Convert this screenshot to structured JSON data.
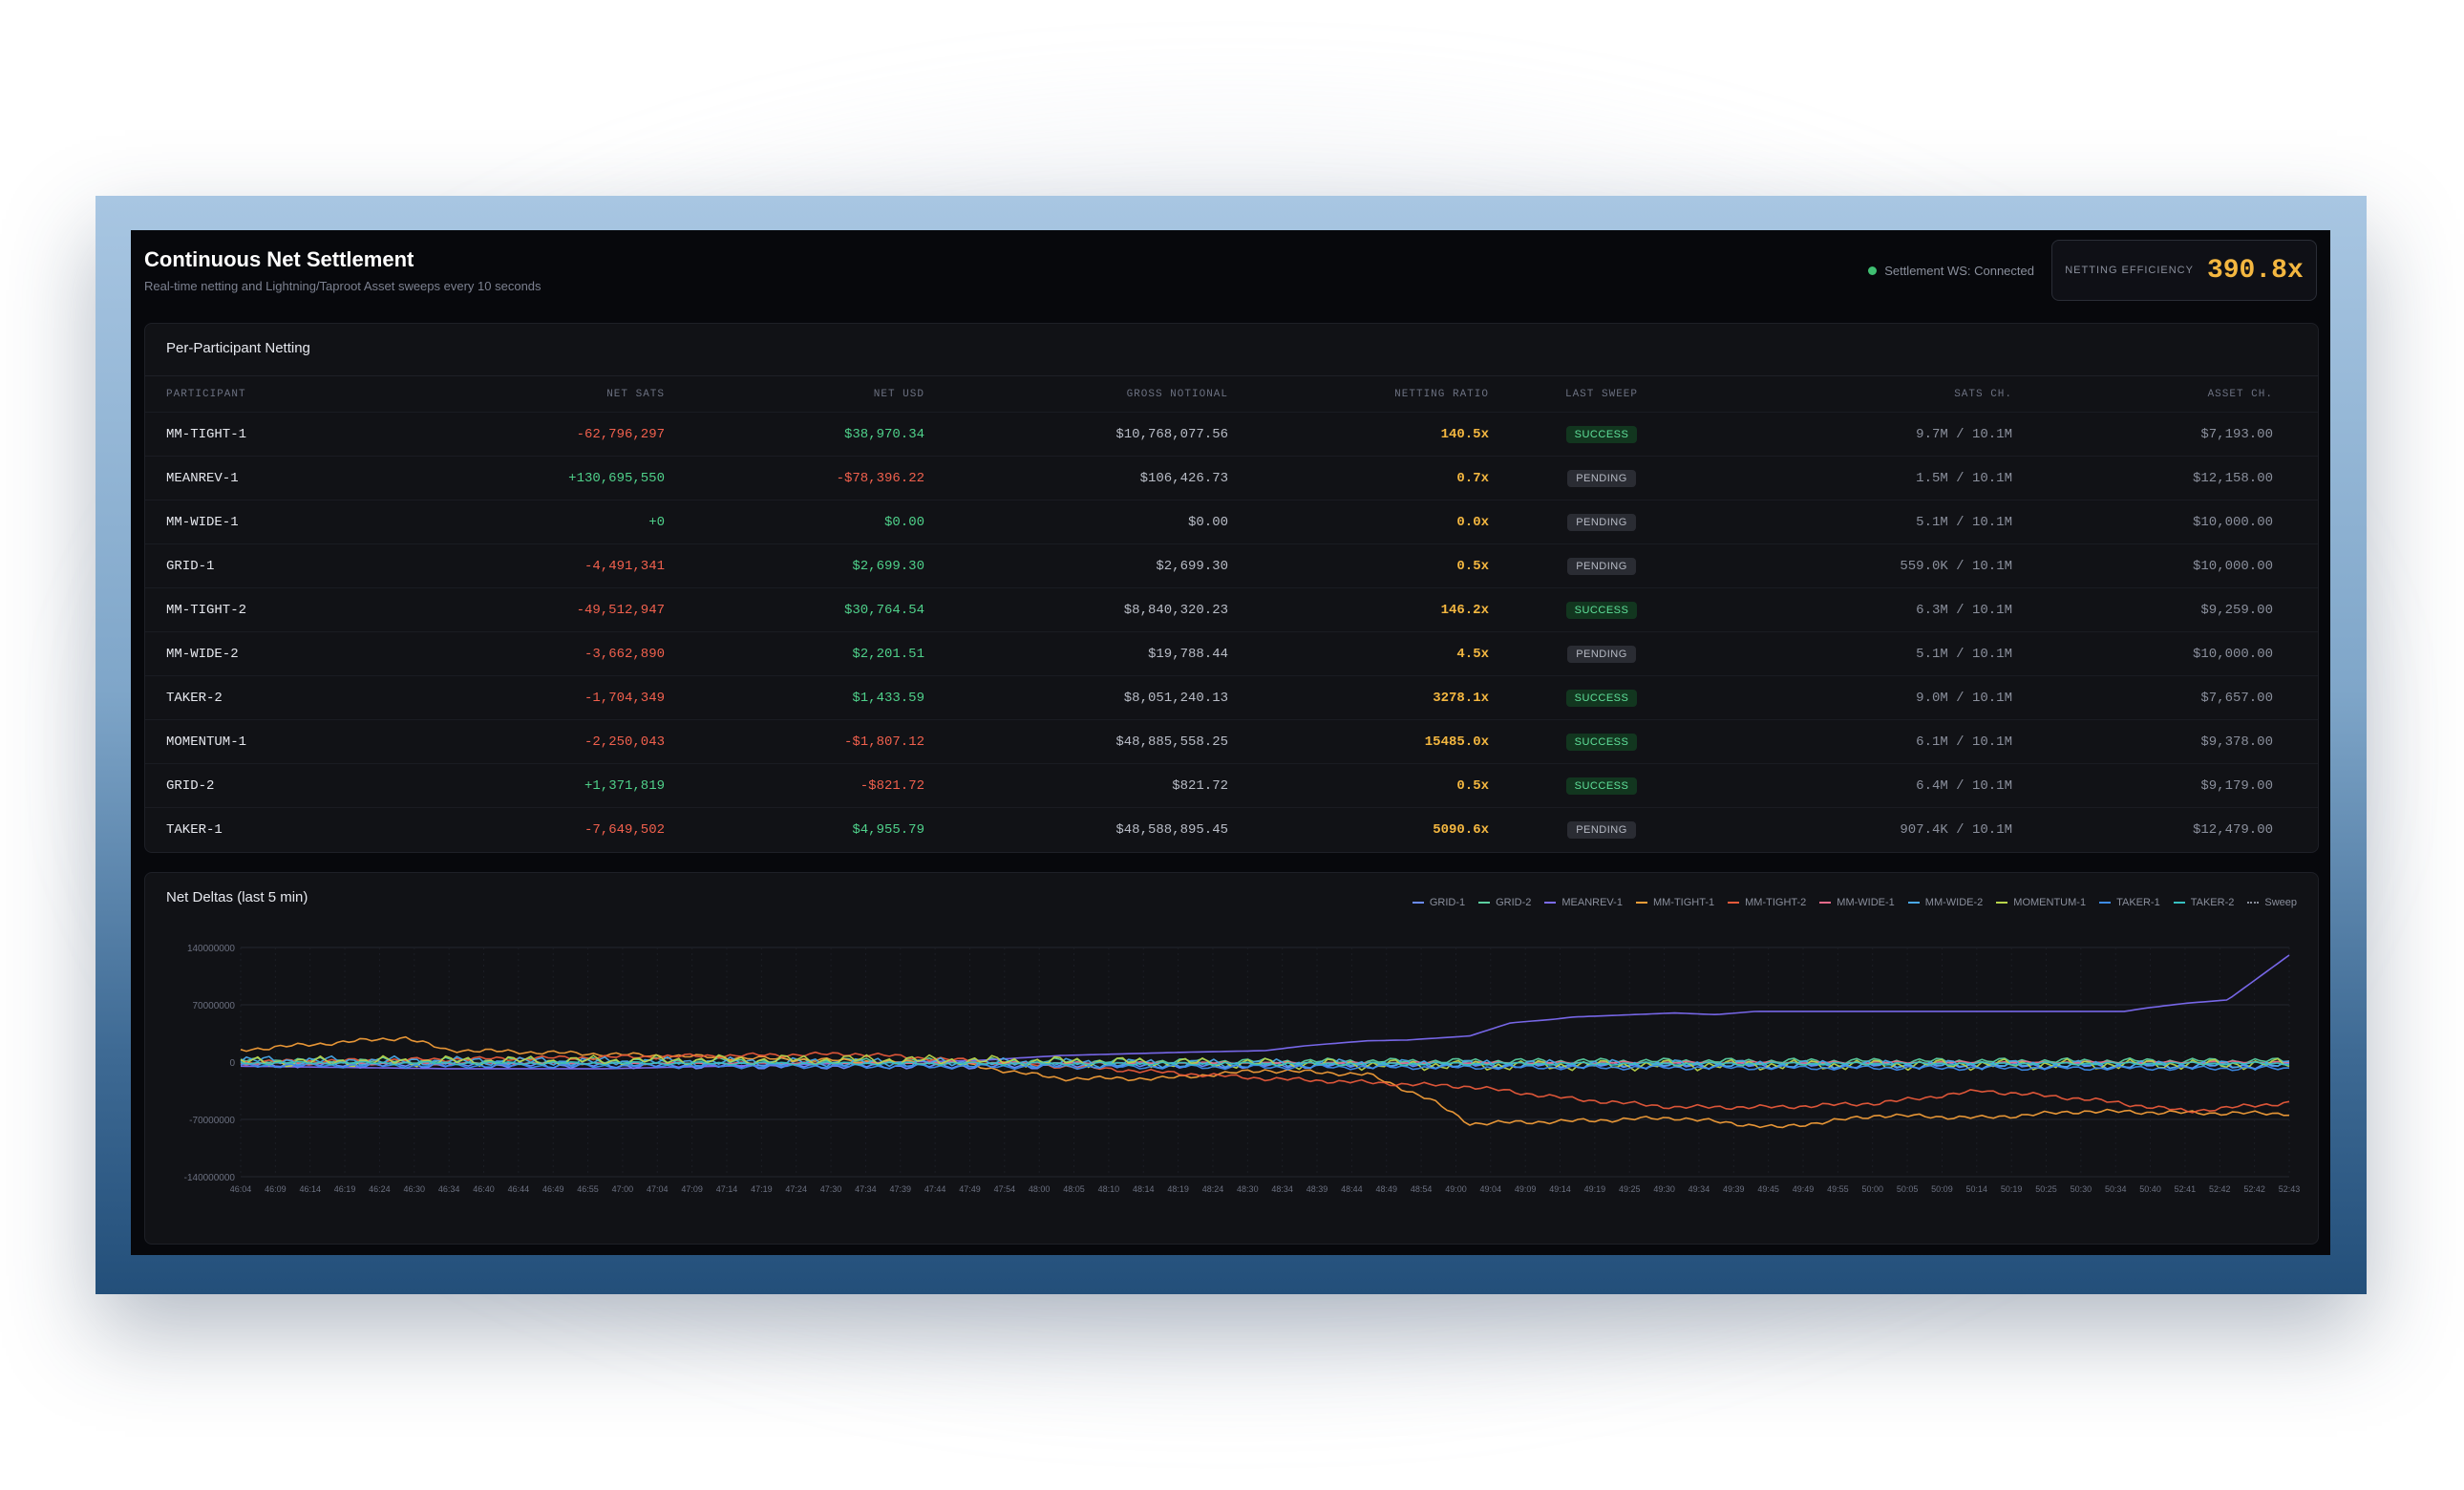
{
  "header": {
    "title": "Continuous Net Settlement",
    "subtitle": "Real-time netting and Lightning/Taproot Asset sweeps every 10 seconds",
    "ws_status": "Settlement WS: Connected",
    "efficiency_label": "NETTING EFFICIENCY",
    "efficiency_value": "390.8x"
  },
  "colors": {
    "positive": "#4fd08a",
    "negative": "#f0604d",
    "ratio": "#f4b740",
    "ws_connected": "#3fbf72"
  },
  "table": {
    "title": "Per-Participant Netting",
    "columns": [
      "PARTICIPANT",
      "NET SATS",
      "NET USD",
      "GROSS NOTIONAL",
      "NETTING RATIO",
      "LAST SWEEP",
      "SATS CH.",
      "ASSET CH."
    ],
    "rows": [
      {
        "participant": "MM-TIGHT-1",
        "net_sats": "-62,796,297",
        "net_usd": "$38,970.34",
        "gross": "$10,768,077.56",
        "ratio": "140.5x",
        "sweep": "SUCCESS",
        "sats_ch": "9.7M / 10.1M",
        "asset_ch": "$7,193.00"
      },
      {
        "participant": "MEANREV-1",
        "net_sats": "+130,695,550",
        "net_usd": "-$78,396.22",
        "gross": "$106,426.73",
        "ratio": "0.7x",
        "sweep": "PENDING",
        "sats_ch": "1.5M / 10.1M",
        "asset_ch": "$12,158.00"
      },
      {
        "participant": "MM-WIDE-1",
        "net_sats": "+0",
        "net_usd": "$0.00",
        "gross": "$0.00",
        "ratio": "0.0x",
        "sweep": "PENDING",
        "sats_ch": "5.1M / 10.1M",
        "asset_ch": "$10,000.00"
      },
      {
        "participant": "GRID-1",
        "net_sats": "-4,491,341",
        "net_usd": "$2,699.30",
        "gross": "$2,699.30",
        "ratio": "0.5x",
        "sweep": "PENDING",
        "sats_ch": "559.0K / 10.1M",
        "asset_ch": "$10,000.00"
      },
      {
        "participant": "MM-TIGHT-2",
        "net_sats": "-49,512,947",
        "net_usd": "$30,764.54",
        "gross": "$8,840,320.23",
        "ratio": "146.2x",
        "sweep": "SUCCESS",
        "sats_ch": "6.3M / 10.1M",
        "asset_ch": "$9,259.00"
      },
      {
        "participant": "MM-WIDE-2",
        "net_sats": "-3,662,890",
        "net_usd": "$2,201.51",
        "gross": "$19,788.44",
        "ratio": "4.5x",
        "sweep": "PENDING",
        "sats_ch": "5.1M / 10.1M",
        "asset_ch": "$10,000.00"
      },
      {
        "participant": "TAKER-2",
        "net_sats": "-1,704,349",
        "net_usd": "$1,433.59",
        "gross": "$8,051,240.13",
        "ratio": "3278.1x",
        "sweep": "SUCCESS",
        "sats_ch": "9.0M / 10.1M",
        "asset_ch": "$7,657.00"
      },
      {
        "participant": "MOMENTUM-1",
        "net_sats": "-2,250,043",
        "net_usd": "-$1,807.12",
        "gross": "$48,885,558.25",
        "ratio": "15485.0x",
        "sweep": "SUCCESS",
        "sats_ch": "6.1M / 10.1M",
        "asset_ch": "$9,378.00"
      },
      {
        "participant": "GRID-2",
        "net_sats": "+1,371,819",
        "net_usd": "-$821.72",
        "gross": "$821.72",
        "ratio": "0.5x",
        "sweep": "SUCCESS",
        "sats_ch": "6.4M / 10.1M",
        "asset_ch": "$9,179.00"
      },
      {
        "participant": "TAKER-1",
        "net_sats": "-7,649,502",
        "net_usd": "$4,955.79",
        "gross": "$48,588,895.45",
        "ratio": "5090.6x",
        "sweep": "PENDING",
        "sats_ch": "907.4K / 10.1M",
        "asset_ch": "$12,479.00"
      }
    ]
  },
  "chart_panel": {
    "title": "Net Deltas (last 5 min)"
  },
  "chart_data": {
    "type": "line",
    "ylim": [
      -140000000,
      140000000
    ],
    "y_ticks": [
      "140000000",
      "70000000",
      "0",
      "-70000000",
      "-140000000"
    ],
    "y_tick_values": [
      140000000,
      70000000,
      0,
      -70000000,
      -140000000
    ],
    "x_tick_labels": [
      "46:04",
      "46:09",
      "46:14",
      "46:19",
      "46:24",
      "46:30",
      "46:34",
      "46:40",
      "46:44",
      "46:49",
      "46:55",
      "47:00",
      "47:04",
      "47:09",
      "47:14",
      "47:19",
      "47:24",
      "47:30",
      "47:34",
      "47:39",
      "47:44",
      "47:49",
      "47:54",
      "48:00",
      "48:05",
      "48:10",
      "48:14",
      "48:19",
      "48:24",
      "48:30",
      "48:34",
      "48:39",
      "48:44",
      "48:49",
      "48:54",
      "49:00",
      "49:04",
      "49:09",
      "49:14",
      "49:19",
      "49:25",
      "49:30",
      "49:34",
      "49:39",
      "49:45",
      "49:49",
      "49:55",
      "50:00",
      "50:05",
      "50:09",
      "50:14",
      "50:19",
      "50:25",
      "50:30",
      "50:34",
      "50:40",
      "52:41",
      "52:42",
      "52:42",
      "52:43"
    ],
    "grid": true,
    "legend_position": "top-right",
    "series": [
      {
        "name": "GRID-1",
        "color": "#6b8cff",
        "points": [
          [
            0,
            -3000000
          ],
          [
            0.3,
            -5000000
          ],
          [
            0.6,
            -4000000
          ],
          [
            1,
            -4491341
          ]
        ],
        "noise": 4000000
      },
      {
        "name": "GRID-2",
        "color": "#5ccfa0",
        "points": [
          [
            0,
            2000000
          ],
          [
            0.5,
            1000000
          ],
          [
            1,
            1371819
          ]
        ],
        "noise": 4000000
      },
      {
        "name": "MEANREV-1",
        "color": "#7c6cf2",
        "points": [
          [
            0,
            -5000000
          ],
          [
            0.1,
            -8000000
          ],
          [
            0.18,
            -8000000
          ],
          [
            0.36,
            2000000
          ],
          [
            0.4,
            8000000
          ],
          [
            0.46,
            12000000
          ],
          [
            0.5,
            14000000
          ],
          [
            0.52,
            20000000
          ],
          [
            0.55,
            26000000
          ],
          [
            0.57,
            27000000
          ],
          [
            0.6,
            32000000
          ],
          [
            0.62,
            48000000
          ],
          [
            0.64,
            52000000
          ],
          [
            0.65,
            55000000
          ],
          [
            0.68,
            58000000
          ],
          [
            0.7,
            60000000
          ],
          [
            0.72,
            58000000
          ],
          [
            0.74,
            62000000
          ],
          [
            0.92,
            62000000
          ],
          [
            0.93,
            66000000
          ],
          [
            0.95,
            72000000
          ],
          [
            0.97,
            76000000
          ],
          [
            1,
            130695550
          ]
        ],
        "noise": 0
      },
      {
        "name": "MM-TIGHT-1",
        "color": "#f29d38",
        "points": [
          [
            0,
            15000000
          ],
          [
            0.08,
            30000000
          ],
          [
            0.1,
            15000000
          ],
          [
            0.35,
            -2000000
          ],
          [
            0.4,
            -20000000
          ],
          [
            0.45,
            -20000000
          ],
          [
            0.5,
            -10000000
          ],
          [
            0.55,
            -15000000
          ],
          [
            0.58,
            -45000000
          ],
          [
            0.6,
            -75000000
          ],
          [
            0.65,
            -72000000
          ],
          [
            0.7,
            -68000000
          ],
          [
            0.75,
            -80000000
          ],
          [
            0.8,
            -65000000
          ],
          [
            0.85,
            -68000000
          ],
          [
            0.9,
            -60000000
          ],
          [
            0.95,
            -62000000
          ],
          [
            1,
            -62796297
          ]
        ],
        "noise": 3000000
      },
      {
        "name": "MM-TIGHT-2",
        "color": "#e85a3a",
        "points": [
          [
            0,
            0
          ],
          [
            0.3,
            10000000
          ],
          [
            0.4,
            -5000000
          ],
          [
            0.5,
            -20000000
          ],
          [
            0.55,
            -25000000
          ],
          [
            0.6,
            -30000000
          ],
          [
            0.65,
            -45000000
          ],
          [
            0.7,
            -55000000
          ],
          [
            0.75,
            -55000000
          ],
          [
            0.8,
            -50000000
          ],
          [
            0.85,
            -35000000
          ],
          [
            0.9,
            -45000000
          ],
          [
            0.95,
            -60000000
          ],
          [
            1,
            -49512947
          ]
        ],
        "noise": 3000000
      },
      {
        "name": "MM-WIDE-1",
        "color": "#e86a8a",
        "points": [
          [
            0,
            -2000000
          ],
          [
            1,
            0
          ]
        ],
        "noise": 1500000
      },
      {
        "name": "MM-WIDE-2",
        "color": "#4aa8e8",
        "points": [
          [
            0,
            2000000
          ],
          [
            0.5,
            -2000000
          ],
          [
            1,
            -3662890
          ]
        ],
        "noise": 6000000
      },
      {
        "name": "MOMENTUM-1",
        "color": "#b8d44a",
        "points": [
          [
            0,
            0
          ],
          [
            0.3,
            3000000
          ],
          [
            0.6,
            -4000000
          ],
          [
            1,
            -2250043
          ]
        ],
        "noise": 7000000
      },
      {
        "name": "TAKER-1",
        "color": "#3d8ce8",
        "points": [
          [
            0,
            -4000000
          ],
          [
            0.5,
            -6000000
          ],
          [
            1,
            -7649502
          ]
        ],
        "noise": 3000000
      },
      {
        "name": "TAKER-2",
        "color": "#36c0c0",
        "points": [
          [
            0,
            -1000000
          ],
          [
            0.5,
            -2000000
          ],
          [
            1,
            -1704349
          ]
        ],
        "noise": 2000000
      },
      {
        "name": "Sweep",
        "color": "#8a8f9c",
        "dashed": true,
        "points": [],
        "noise": 0
      }
    ]
  }
}
